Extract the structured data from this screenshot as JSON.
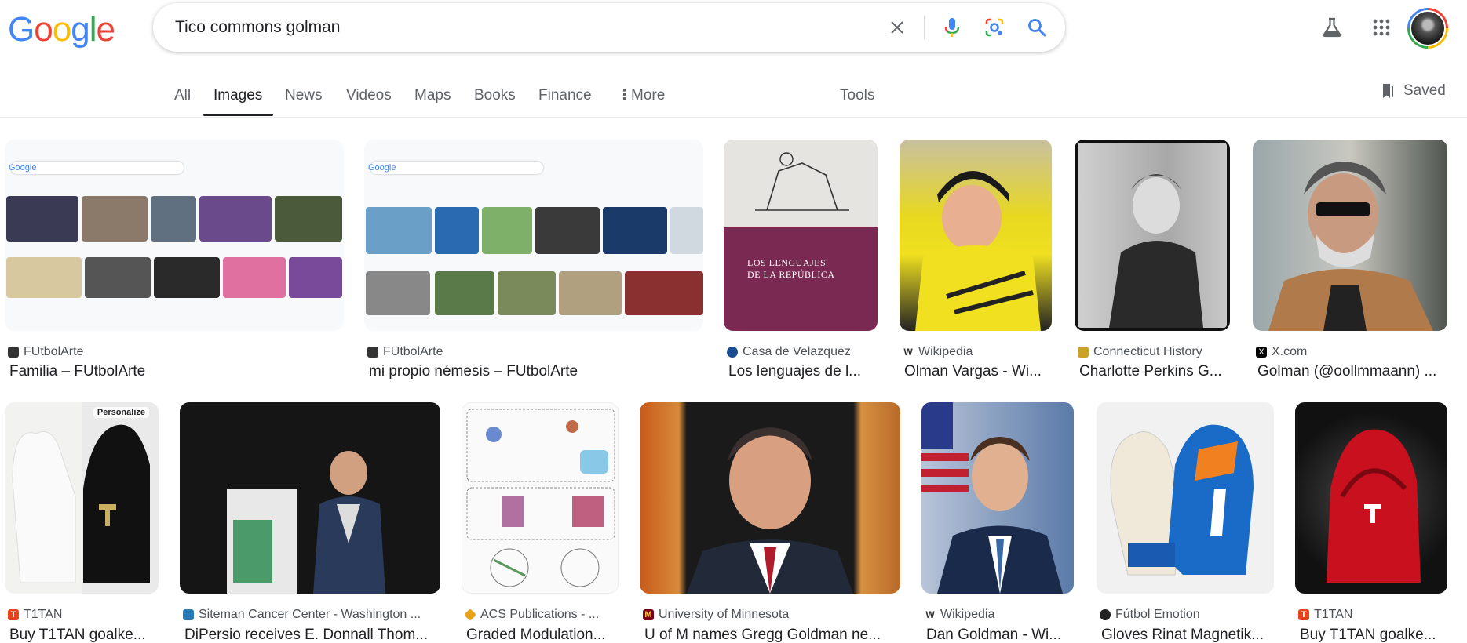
{
  "logo": [
    "G",
    "o",
    "o",
    "g",
    "l",
    "e"
  ],
  "logo_colors": [
    "#4285f4",
    "#ea4335",
    "#fbbc05",
    "#4285f4",
    "#34a853",
    "#ea4335"
  ],
  "search": {
    "value": "Tico commons golman"
  },
  "tabs": [
    {
      "label": "All"
    },
    {
      "label": "Images"
    },
    {
      "label": "News"
    },
    {
      "label": "Videos"
    },
    {
      "label": "Maps"
    },
    {
      "label": "Books"
    },
    {
      "label": "Finance"
    },
    {
      "label": "More"
    }
  ],
  "tools_label": "Tools",
  "saved_label": "Saved",
  "results": [
    {
      "source": "FUtbolArte",
      "title": "Familia – FUtbolArte",
      "favicon_color": "#333333"
    },
    {
      "source": "FUtbolArte",
      "title": "mi propio némesis – FUtbolArte",
      "favicon_color": "#333333"
    },
    {
      "source": "Casa de Velazquez",
      "title": "Los lenguajes de l...",
      "favicon_color": "#1a4d8f"
    },
    {
      "source": "Wikipedia",
      "title": "Olman Vargas - Wi...",
      "favicon_color": "#555555"
    },
    {
      "source": "Connecticut History",
      "title": "Charlotte Perkins G...",
      "favicon_color": "#c9a227"
    },
    {
      "source": "X.com",
      "title": "Golman (@oollmmaann) ...",
      "favicon_color": "#000000"
    },
    {
      "source": "T1TAN",
      "title": "Buy T1TAN goalke...",
      "favicon_color": "#e8421c"
    },
    {
      "source": "Siteman Cancer Center - Washington ...",
      "title": "DiPersio receives E. Donnall Thom...",
      "favicon_color": "#2a7ab8"
    },
    {
      "source": "ACS Publications - ...",
      "title": "Graded Modulation...",
      "favicon_color": "#e8a317"
    },
    {
      "source": "University of Minnesota",
      "title": "U of M names Gregg Goldman ne...",
      "favicon_color": "#7a0019"
    },
    {
      "source": "Wikipedia",
      "title": "Dan Goldman - Wi...",
      "favicon_color": "#555555"
    },
    {
      "source": "Fútbol Emotion",
      "title": "Gloves Rinat Magnetik...",
      "favicon_color": "#222222"
    },
    {
      "source": "T1TAN",
      "title": "Buy T1TAN goalke...",
      "favicon_color": "#e8421c"
    }
  ],
  "book_cover": {
    "line1": "LOS LENGUAJES",
    "line2": "DE LA REPÚBLICA"
  },
  "personalize_label": "Personalize"
}
